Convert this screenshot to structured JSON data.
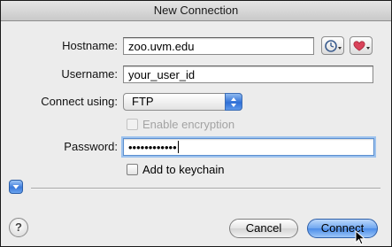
{
  "dialog": {
    "title": "New Connection"
  },
  "form": {
    "hostname_label": "Hostname:",
    "hostname_value": "zoo.uvm.edu",
    "username_label": "Username:",
    "username_value": "your_user_id",
    "connect_using_label": "Connect using:",
    "connect_using_value": "FTP",
    "enable_encryption_label": "Enable encryption",
    "enable_encryption_checked": false,
    "enable_encryption_enabled": false,
    "password_label": "Password:",
    "password_masked": "••••••••••••",
    "add_keychain_label": "Add to keychain",
    "add_keychain_checked": false
  },
  "icons": {
    "history": "clock-icon",
    "favorites": "heart-icon",
    "disclosure": "disclosure-triangle-icon",
    "help": "help-icon",
    "pointer": "mouse-pointer-icon"
  },
  "help_glyph": "?",
  "buttons": {
    "cancel": "Cancel",
    "connect": "Connect"
  },
  "colors": {
    "focus_ring": "#9ec3ee",
    "default_button": "#4b8ce8",
    "heart": "#d9435a"
  }
}
